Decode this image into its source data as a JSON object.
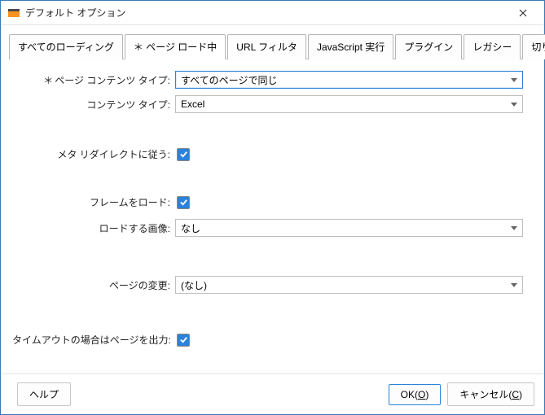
{
  "window": {
    "title": "デフォルト オプション"
  },
  "tabs": {
    "t0": "すべてのローディング",
    "t1": "＊ ページ ロード中",
    "t2": "URL フィルタ",
    "t3": "JavaScript 実行",
    "t4": "プラグイン",
    "t5": "レガシー",
    "t6": "切り替え"
  },
  "labels": {
    "pageContentType": "ページ コンテンツ タイプ:",
    "contentType": "コンテンツ タイプ:",
    "metaRedirect": "メタ リダイレクトに従う:",
    "loadFrames": "フレームをロード:",
    "loadImages": "ロードする画像:",
    "pageChange": "ページの変更:",
    "timeoutOutput": "タイムアウトの場合はページを出力:"
  },
  "values": {
    "pageContentType": "すべてのページで同じ",
    "contentType": "Excel",
    "loadImages": "なし",
    "pageChange": "(なし)"
  },
  "buttons": {
    "help": "ヘルプ",
    "ok_pre": "OK(",
    "ok_u": "O",
    "ok_post": ")",
    "cancel_pre": "キャンセル(",
    "cancel_u": "C",
    "cancel_post": ")"
  }
}
